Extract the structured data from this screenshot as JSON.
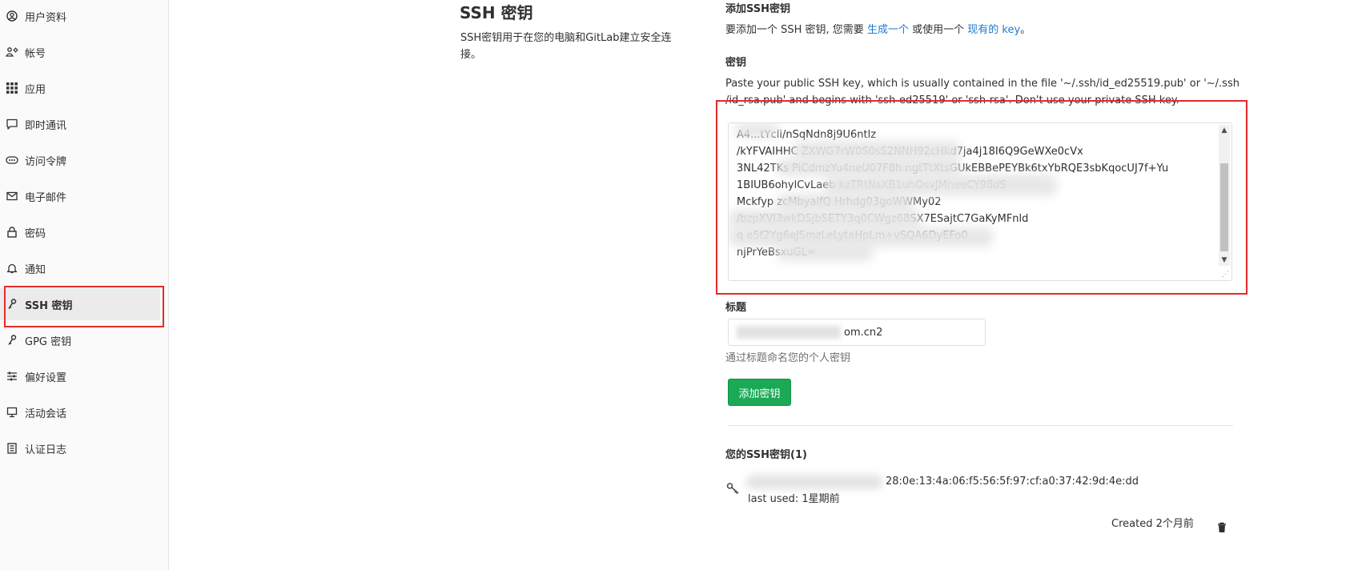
{
  "sidebar": {
    "items": [
      {
        "label": "用户资料",
        "icon": "user-circle-icon"
      },
      {
        "label": "帐号",
        "icon": "account-icon"
      },
      {
        "label": "应用",
        "icon": "applications-icon"
      },
      {
        "label": "即时通讯",
        "icon": "chat-icon"
      },
      {
        "label": "访问令牌",
        "icon": "token-icon"
      },
      {
        "label": "电子邮件",
        "icon": "mail-icon"
      },
      {
        "label": "密码",
        "icon": "lock-icon"
      },
      {
        "label": "通知",
        "icon": "bell-icon"
      },
      {
        "label": "SSH 密钥",
        "icon": "key-icon",
        "active": true
      },
      {
        "label": "GPG 密钥",
        "icon": "key-icon"
      },
      {
        "label": "偏好设置",
        "icon": "preferences-icon"
      },
      {
        "label": "活动会话",
        "icon": "monitor-icon"
      },
      {
        "label": "认证日志",
        "icon": "log-icon"
      }
    ]
  },
  "page": {
    "title": "SSH 密钥",
    "description": "SSH密钥用于在您的电脑和GitLab建立安全连接。"
  },
  "form": {
    "add_heading": "添加SSH密钥",
    "add_intro_prefix": "要添加一个 SSH 密钥, 您需要",
    "add_intro_link1": "生成一个",
    "add_intro_mid": "或使用一个",
    "add_intro_link2": "现有的 key",
    "add_intro_suffix": "。",
    "key_label": "密钥",
    "key_help_line1": "Paste your public SSH key, which is usually contained in the file '~/.ssh/id_ed25519.pub' or '~/.ssh",
    "key_help_line2": "/id_rsa.pub' and begins with 'ssh-ed25519' or 'ssh-rsa'. Don't use your private SSH key.",
    "key_lines": [
      "        A4...tYcli/nSqNdn8j9U6ntlz",
      "/kYFVAIHHC                             ZXWG7rW0S0sS2NNH92cHkd7ja4j18I6Q9GeWXe0cVx",
      "3NL42TKs           PiCdmzYu4neU07F8h   ngtTtXtsGUkEBBePEYBk6txYbRQE3sbKqocUJ7f+Yu",
      "1BIUB6ohylCvLaeb                            kzTRtNsXB1uhOsvJMneeCY98dS",
      "Mckfyp              zcMbyaifQ          Hrhdg03goWWMy02",
      "                                      /bzpXVl3wkDSjbSETY3q0CWgz68SX7ESajtC7GaKyMFnld",
      "                   q                        e5f2Yg6eJSmzLeLytaHpLm+vSQA6DyEFo0",
      "njPrYeBsxuGL="
    ],
    "title_label": "标题",
    "title_value": "om.cn2",
    "title_help": "通过标题命名您的个人密钥",
    "submit_label": "添加密钥"
  },
  "keys_list": {
    "heading": "您的SSH密钥(1)",
    "items": [
      {
        "fingerprint": "28:0e:13:4a:06:f5:56:5f:97:cf:a0:37:42:9d:4e:dd",
        "last_used": "last used: 1星期前",
        "created": "Created 2个月前"
      }
    ]
  }
}
